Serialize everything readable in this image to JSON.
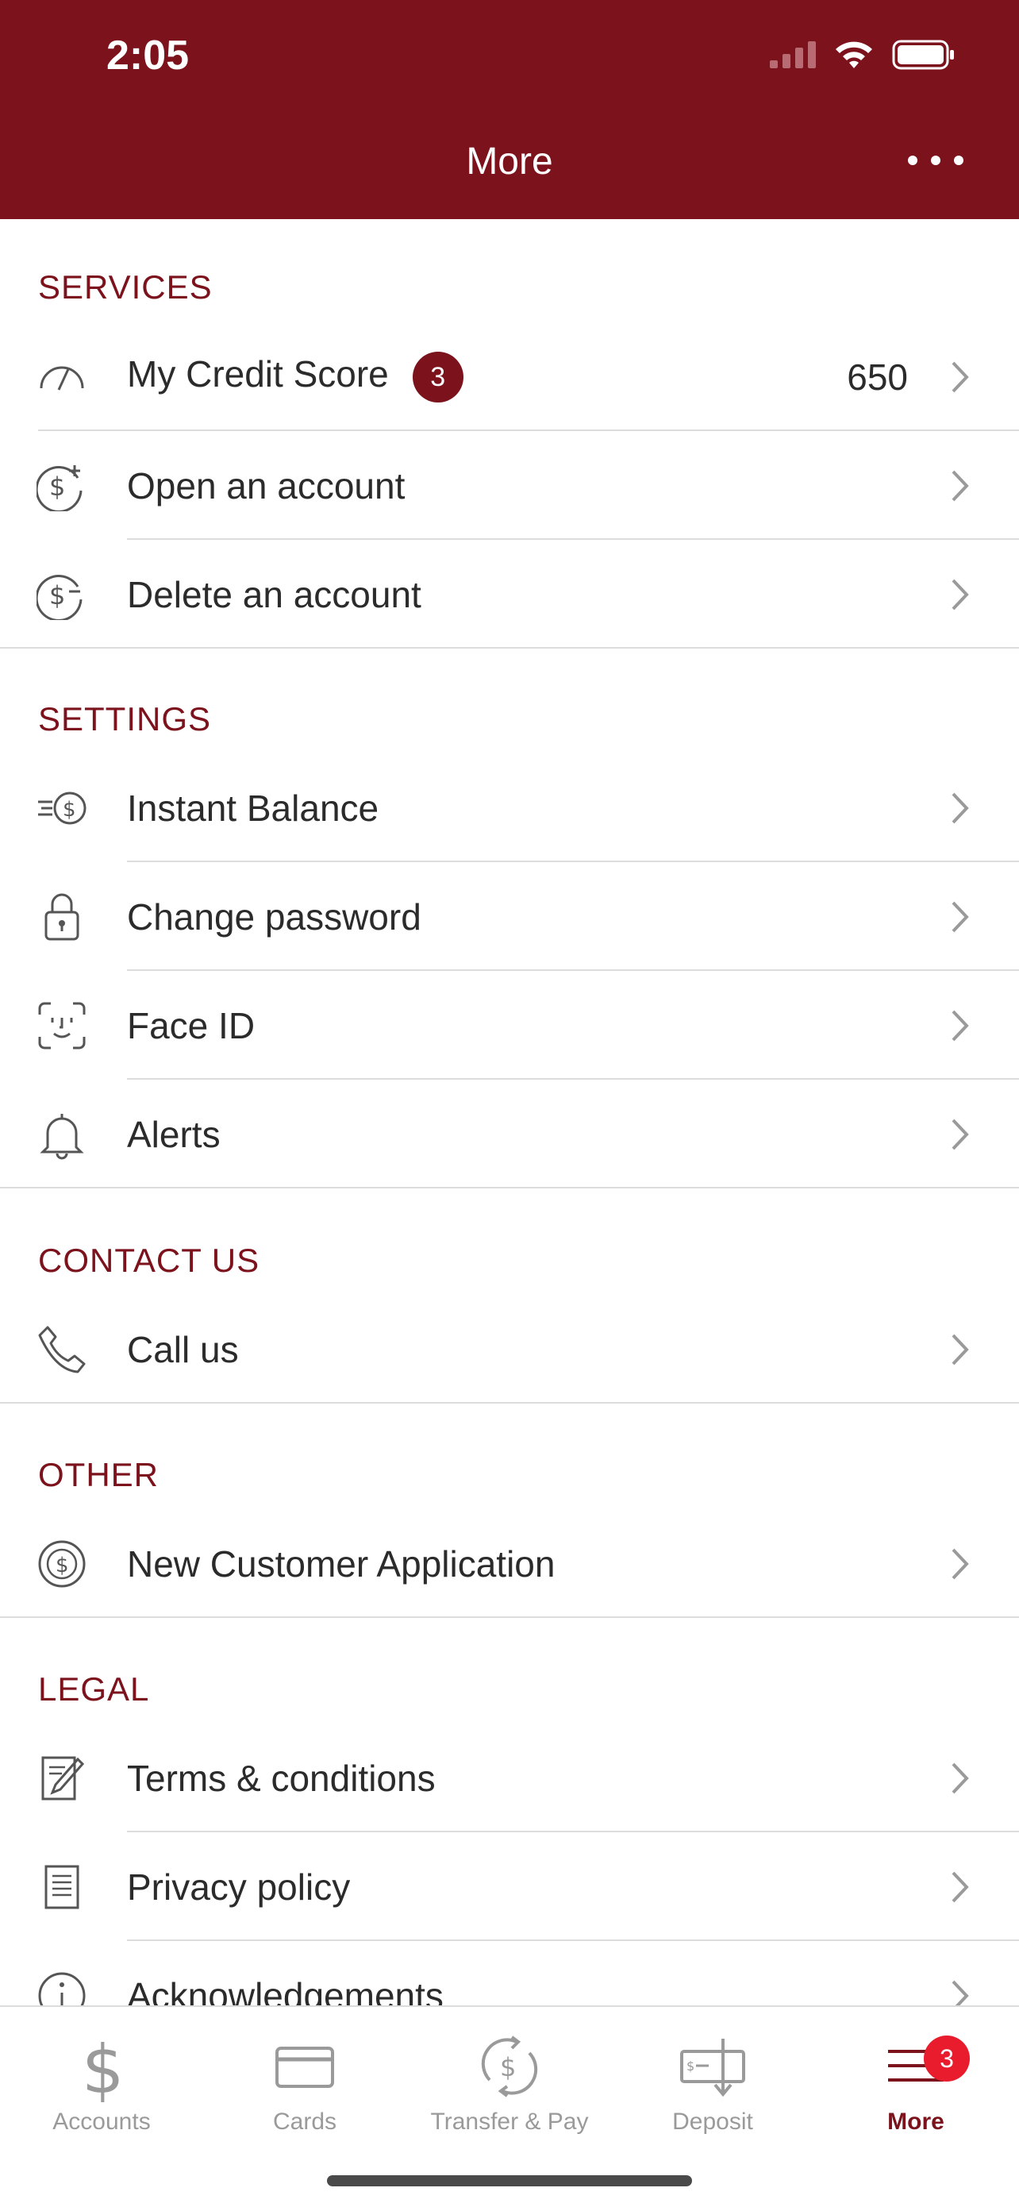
{
  "status": {
    "time": "2:05"
  },
  "header": {
    "title": "More"
  },
  "sections": {
    "services": "SERVICES",
    "settings": "SETTINGS",
    "contact": "CONTACT US",
    "other": "OTHER",
    "legal": "LEGAL"
  },
  "services": {
    "credit_score_label": "My Credit Score",
    "credit_score_badge": "3",
    "credit_score_value": "650",
    "open_account": "Open an account",
    "delete_account": "Delete an account"
  },
  "settings": {
    "instant_balance": "Instant Balance",
    "change_password": "Change password",
    "face_id": "Face ID",
    "alerts": "Alerts"
  },
  "contact": {
    "call_us": "Call us"
  },
  "other": {
    "new_customer_application": "New Customer Application"
  },
  "legal": {
    "terms": "Terms & conditions",
    "privacy": "Privacy policy",
    "acknowledgements": "Acknowledgements"
  },
  "tabbar": {
    "accounts": "Accounts",
    "cards": "Cards",
    "transfer_pay": "Transfer & Pay",
    "deposit": "Deposit",
    "more": "More",
    "more_badge": "3"
  },
  "colors": {
    "brand": "#7b121c",
    "badge_red": "#e81c2c",
    "text": "#2b2b2b",
    "muted": "#9a9a9a"
  },
  "icons": {
    "credit": "speedometer-icon",
    "open": "dollar-plus-icon",
    "delete": "dollar-minus-icon",
    "instant": "fast-dollar-icon",
    "password": "lock-icon",
    "faceid": "face-id-icon",
    "alerts": "bell-icon",
    "call": "phone-icon",
    "application": "dollar-coin-icon",
    "terms": "document-pen-icon",
    "privacy": "document-icon",
    "ack": "info-icon"
  }
}
